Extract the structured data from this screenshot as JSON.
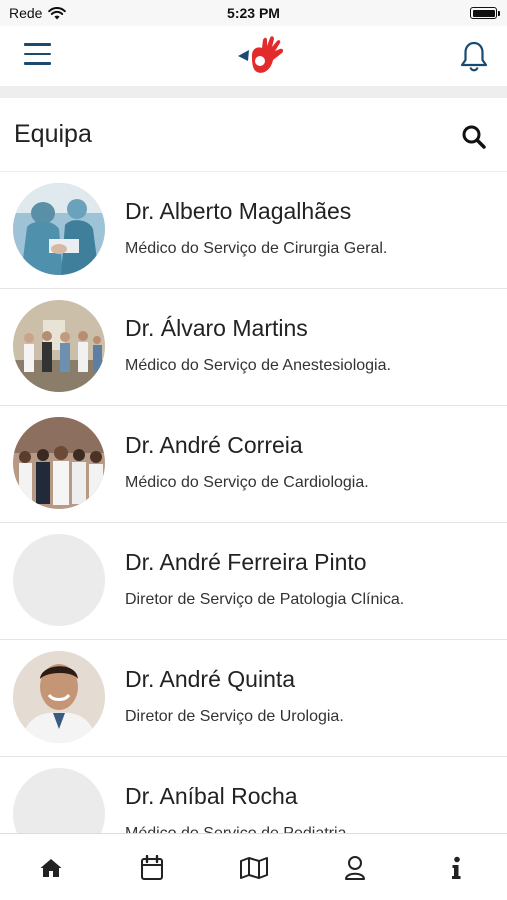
{
  "status_bar": {
    "carrier": "Rede",
    "time": "5:23 PM",
    "battery_level": 1.0
  },
  "header": {
    "menu_icon": "hamburger-icon",
    "logo": "hand-logo",
    "notifications_icon": "bell-icon"
  },
  "section": {
    "title": "Equipa",
    "search_icon": "search-icon"
  },
  "doctors": [
    {
      "name": "Dr. Alberto Magalhães",
      "role": "Médico do Serviço de Cirurgia Geral.",
      "avatar": "photo-surgery"
    },
    {
      "name": "Dr. Álvaro Martins",
      "role": "Médico do Serviço de Anestesiologia.",
      "avatar": "photo-team-room"
    },
    {
      "name": "Dr. André Correia",
      "role": "Médico do Serviço de Cardiologia.",
      "avatar": "photo-group"
    },
    {
      "name": "Dr. André Ferreira Pinto",
      "role": "Diretor de Serviço de Patologia Clínica.",
      "avatar": "placeholder"
    },
    {
      "name": "Dr. André Quinta",
      "role": "Diretor de Serviço de Urologia.",
      "avatar": "photo-portrait"
    },
    {
      "name": "Dr. Aníbal Rocha",
      "role": "Médico do Serviço de Pediatria.",
      "avatar": "placeholder"
    }
  ],
  "tabs": [
    {
      "icon": "home-icon"
    },
    {
      "icon": "calendar-icon"
    },
    {
      "icon": "map-icon"
    },
    {
      "icon": "user-icon"
    },
    {
      "icon": "info-icon"
    }
  ],
  "colors": {
    "accent": "#1b4a70",
    "logo_red": "#e32b2b",
    "logo_blue": "#1b4a70",
    "placeholder": "#ebebeb",
    "separator": "#eeeeee"
  }
}
